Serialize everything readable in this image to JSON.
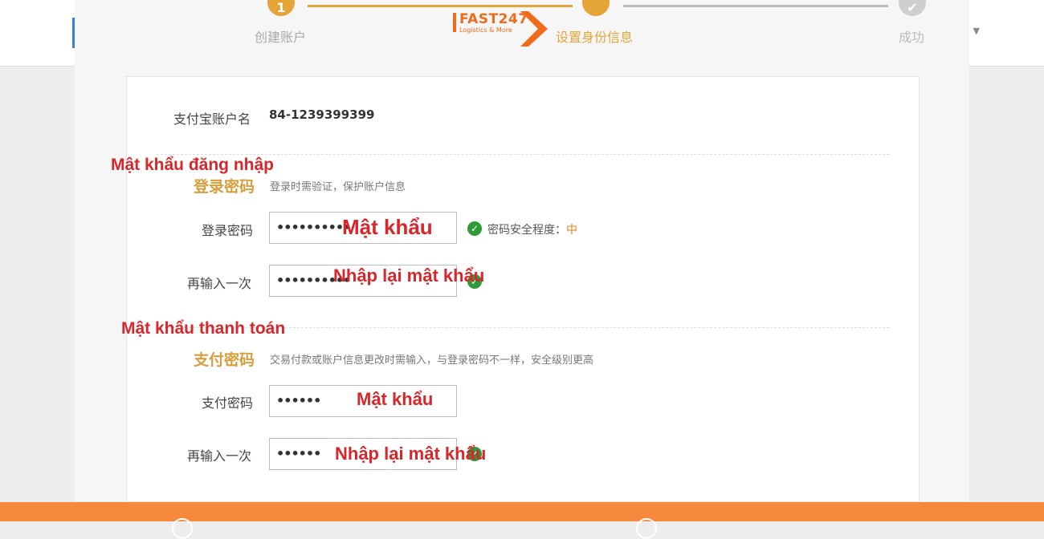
{
  "header": {
    "lang_selector": "n"
  },
  "steps": [
    {
      "number": "1",
      "label": "创建账户"
    },
    {
      "label": "设置身份信息"
    },
    {
      "label": "成功"
    }
  ],
  "logo": {
    "name": "FAST247",
    "tagline": "Logistics & More"
  },
  "account": {
    "label": "支付宝账户名",
    "value": "84-1239399399"
  },
  "login_section": {
    "title": "登录密码",
    "desc": "登录时需验证，保护账户信息",
    "password_label": "登录密码",
    "password_value": "••••••••••",
    "confirm_label": "再输入一次",
    "confirm_value": "••••••••••",
    "strength_label": "密码安全程度：",
    "strength_level": "中"
  },
  "payment_section": {
    "title": "支付密码",
    "desc": "交易付款或账户信息更改时需输入，与登录密码不一样，安全级别更高",
    "password_label": "支付密码",
    "password_value": "••••••",
    "confirm_label": "再输入一次",
    "confirm_value": "••••••"
  },
  "annotations": {
    "login_heading": "Mật khẩu đăng nhập",
    "login_password": "Mật khẩu",
    "login_confirm": "Nhập lại mật khẩu",
    "payment_heading": "Mật khẩu thanh toán",
    "payment_password": "Mật khẩu",
    "payment_confirm": "Nhập lại mật khẩu"
  },
  "colors": {
    "accent": "#e5a438",
    "annotation": "#d8262a",
    "footer": "#f6893b",
    "success": "#2f9a3a"
  }
}
